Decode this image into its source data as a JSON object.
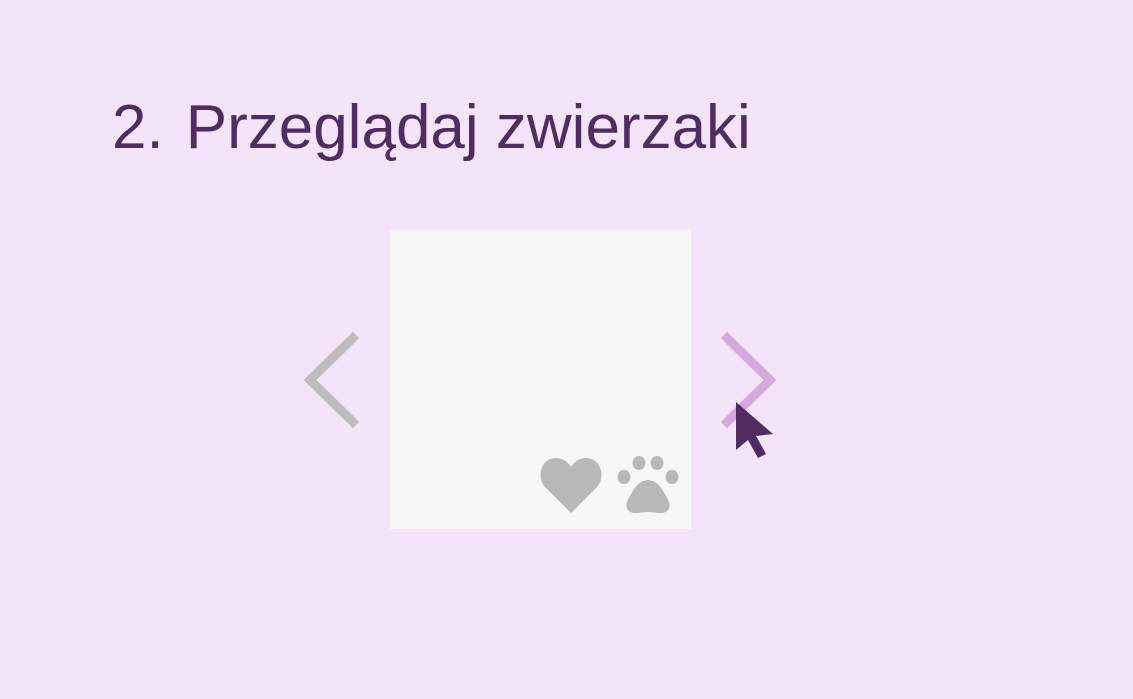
{
  "step": {
    "number": "2.",
    "title": "Przeglądaj zwierzaki"
  },
  "carousel": {
    "prev_icon": "chevron-left-icon",
    "next_icon": "chevron-right-icon",
    "card": {
      "actions": [
        {
          "icon": "heart-icon"
        },
        {
          "icon": "paw-icon"
        }
      ]
    }
  },
  "pointer": {
    "icon": "mouse-pointer-icon"
  },
  "colors": {
    "background": "#f3e5f7",
    "title": "#512c62",
    "arrow_inactive": "#bdbdbd",
    "arrow_active": "#d7a8dd",
    "card": "#f7f7f7",
    "card_icons": "#b8b8b8",
    "cursor": "#512c62"
  }
}
